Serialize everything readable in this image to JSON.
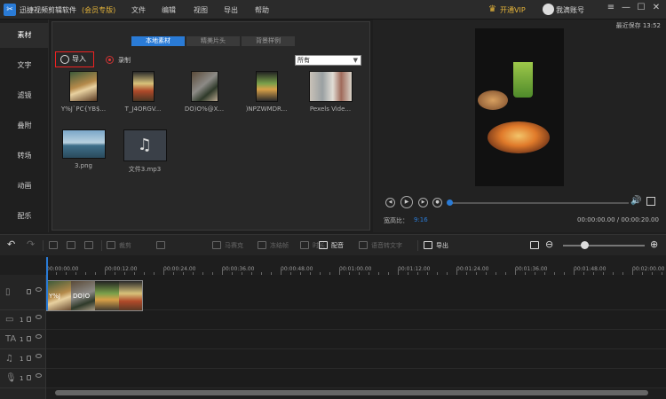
{
  "app": {
    "logo_glyph": "✂",
    "title": "迅捷视频剪辑软件",
    "edition": "(会员专版)"
  },
  "menu": [
    "文件",
    "编辑",
    "视图",
    "导出",
    "帮助"
  ],
  "header": {
    "vip_label": "开通VIP",
    "vip_icon": "crown-icon",
    "account": "我滴账号",
    "window_glyphs": [
      "≡",
      "—",
      "☐",
      "✕"
    ]
  },
  "save_status": "最近保存 13:52",
  "sidebar": [
    "素材",
    "文字",
    "滤镜",
    "叠附",
    "转场",
    "动画",
    "配乐"
  ],
  "library": {
    "tabs": [
      "本地素材",
      "精美片头",
      "背景样例"
    ],
    "import_label": "导入",
    "record_label": "录制",
    "filter_value": "所有",
    "filter_arrow": "▼",
    "files": [
      "Y%J`PC{YB$...",
      "T_J4ORGV...",
      "DO)O%@X...",
      ")NPZWMDR...",
      "Pexels Vide...",
      "3.png",
      "文件3.mp3"
    ]
  },
  "player": {
    "buttons": [
      "◀",
      "▶",
      "▶",
      "●"
    ],
    "volume_glyph": "🔊",
    "ratio_label": "宽高比：",
    "ratio_value": "9:16",
    "timecode": "00:00:00.00 / 00:00:20.00",
    "progress": 0.0
  },
  "toolbar": {
    "undo": "↶",
    "redo": "↷",
    "labels": [
      "裁剪",
      "马赛克",
      "冻结帧",
      "时长",
      "配音",
      "语音转文字",
      "导出"
    ],
    "zoom_out": "⊖",
    "zoom_in": "⊕",
    "zoom_level": 0.25
  },
  "ruler": [
    "00:00:00.00",
    "00:00:12.00",
    "00:00:24.00",
    "00:00:36.00",
    "00:00:48.00",
    "00:01:00.00",
    "00:01:12.00",
    "00:01:24.00",
    "00:01:36.00",
    "00:01:48.00",
    "00:02:00.00"
  ],
  "tracks": {
    "icons": [
      "▯",
      "▭",
      "TA",
      "♫",
      "🎙"
    ],
    "nums": [
      "",
      "1",
      "1",
      "1",
      "1"
    ],
    "clip_texts": [
      "Y%J",
      "DO)O"
    ]
  },
  "colors": {
    "accent": "#2a7bd6",
    "vip": "#e5b43a",
    "highlight": "#e22222"
  }
}
